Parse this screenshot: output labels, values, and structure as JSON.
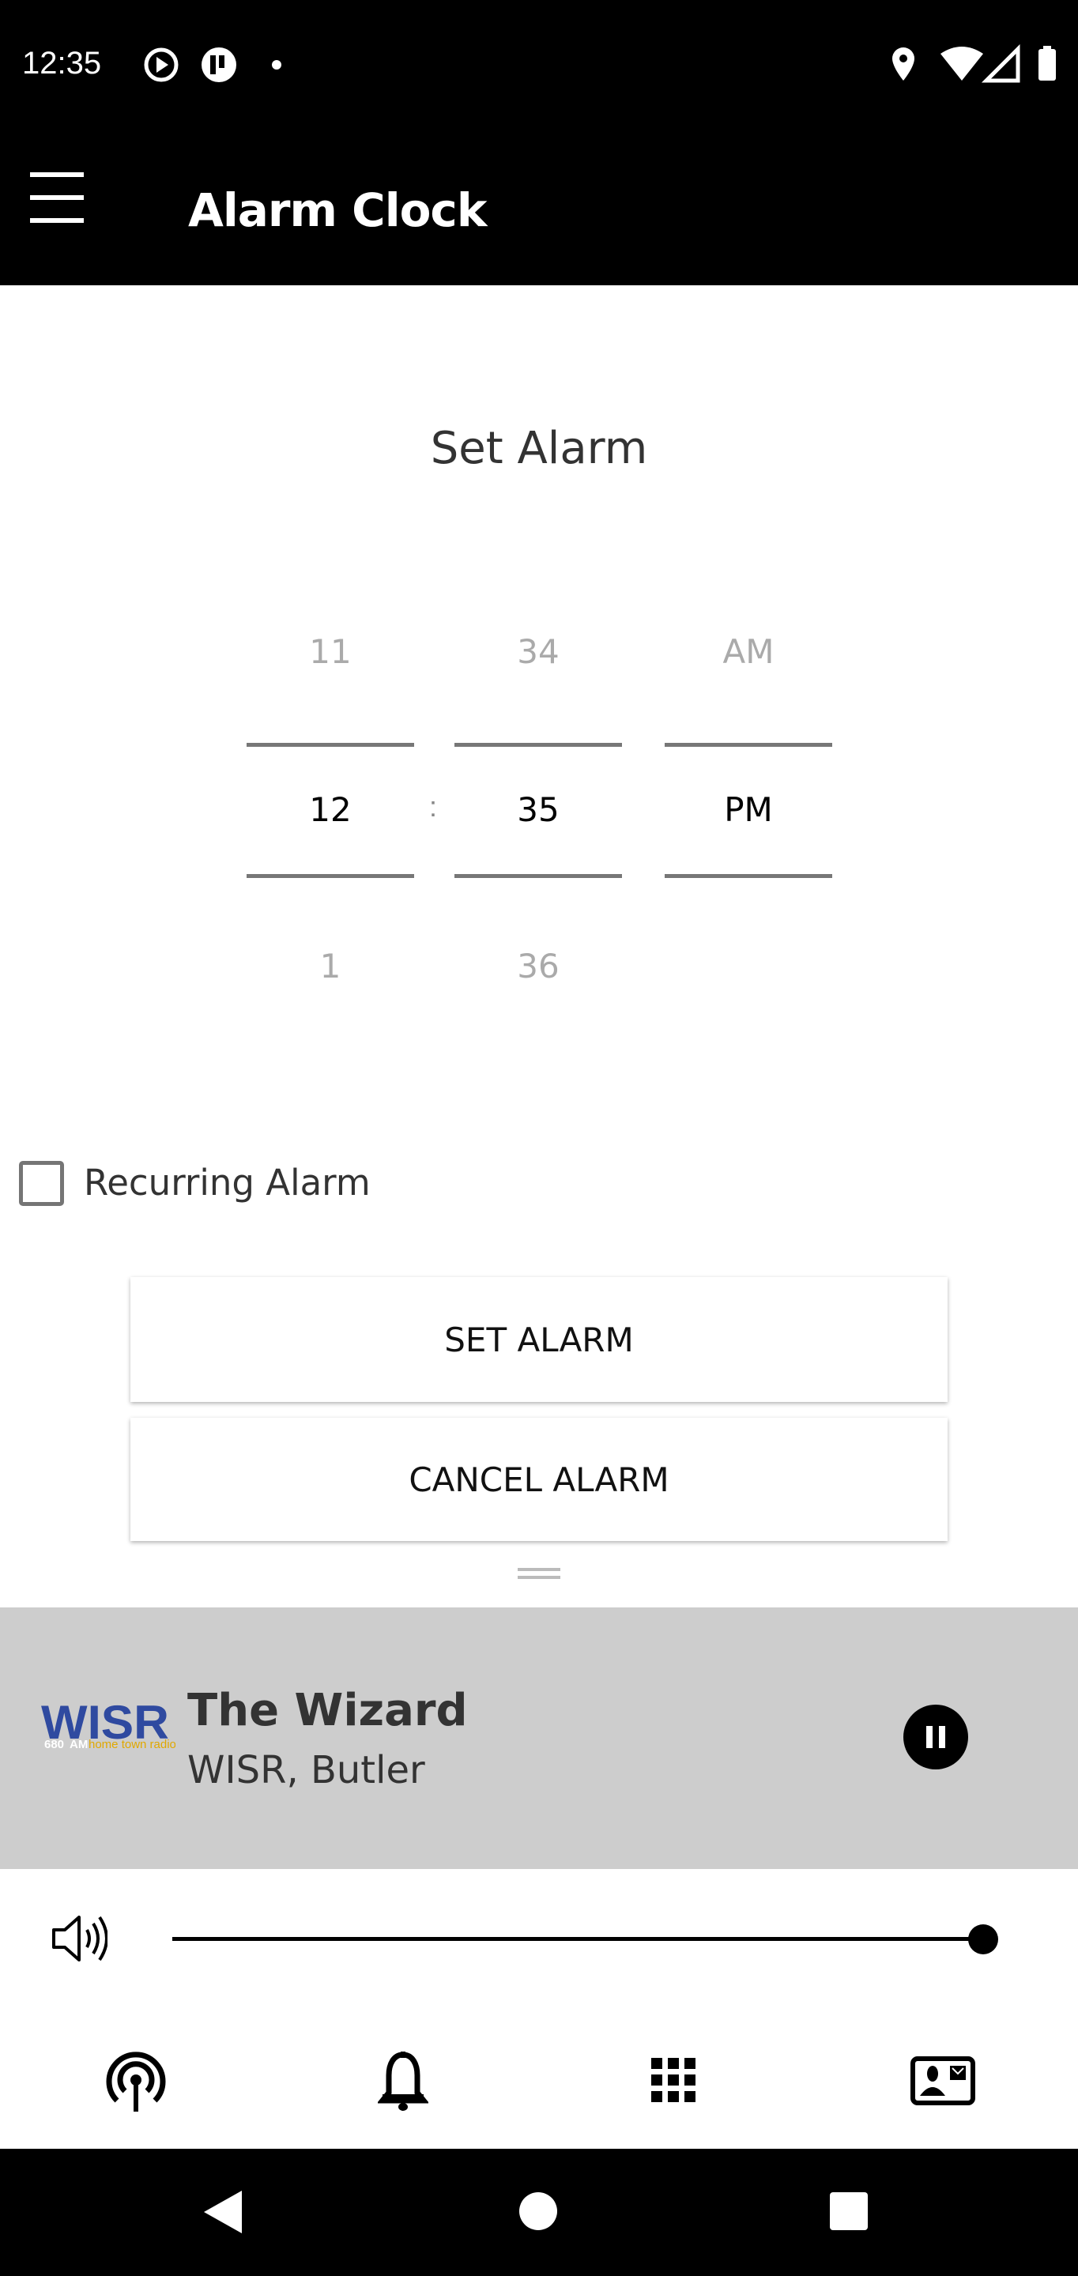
{
  "status_bar": {
    "time": "12:35"
  },
  "app_bar": {
    "title": "Alarm Clock"
  },
  "main": {
    "heading": "Set Alarm",
    "picker": {
      "hour": {
        "prev": "11",
        "selected": "12",
        "next": "1"
      },
      "separator": ":",
      "minute": {
        "prev": "34",
        "selected": "35",
        "next": "36"
      },
      "ampm": {
        "prev": "AM",
        "selected": "PM"
      }
    },
    "recurring": {
      "label": "Recurring Alarm",
      "checked": false
    },
    "set_label": "SET ALARM",
    "cancel_label": "CANCEL ALARM"
  },
  "player": {
    "logo_text": "WISR 680 AM home town radio",
    "title": "The Wizard",
    "subtitle": "WISR, Butler",
    "state": "playing",
    "volume": 1.0
  },
  "bottom_nav": [
    "radio-tower-icon",
    "bell-icon",
    "grid-icon",
    "contact-card-icon"
  ]
}
